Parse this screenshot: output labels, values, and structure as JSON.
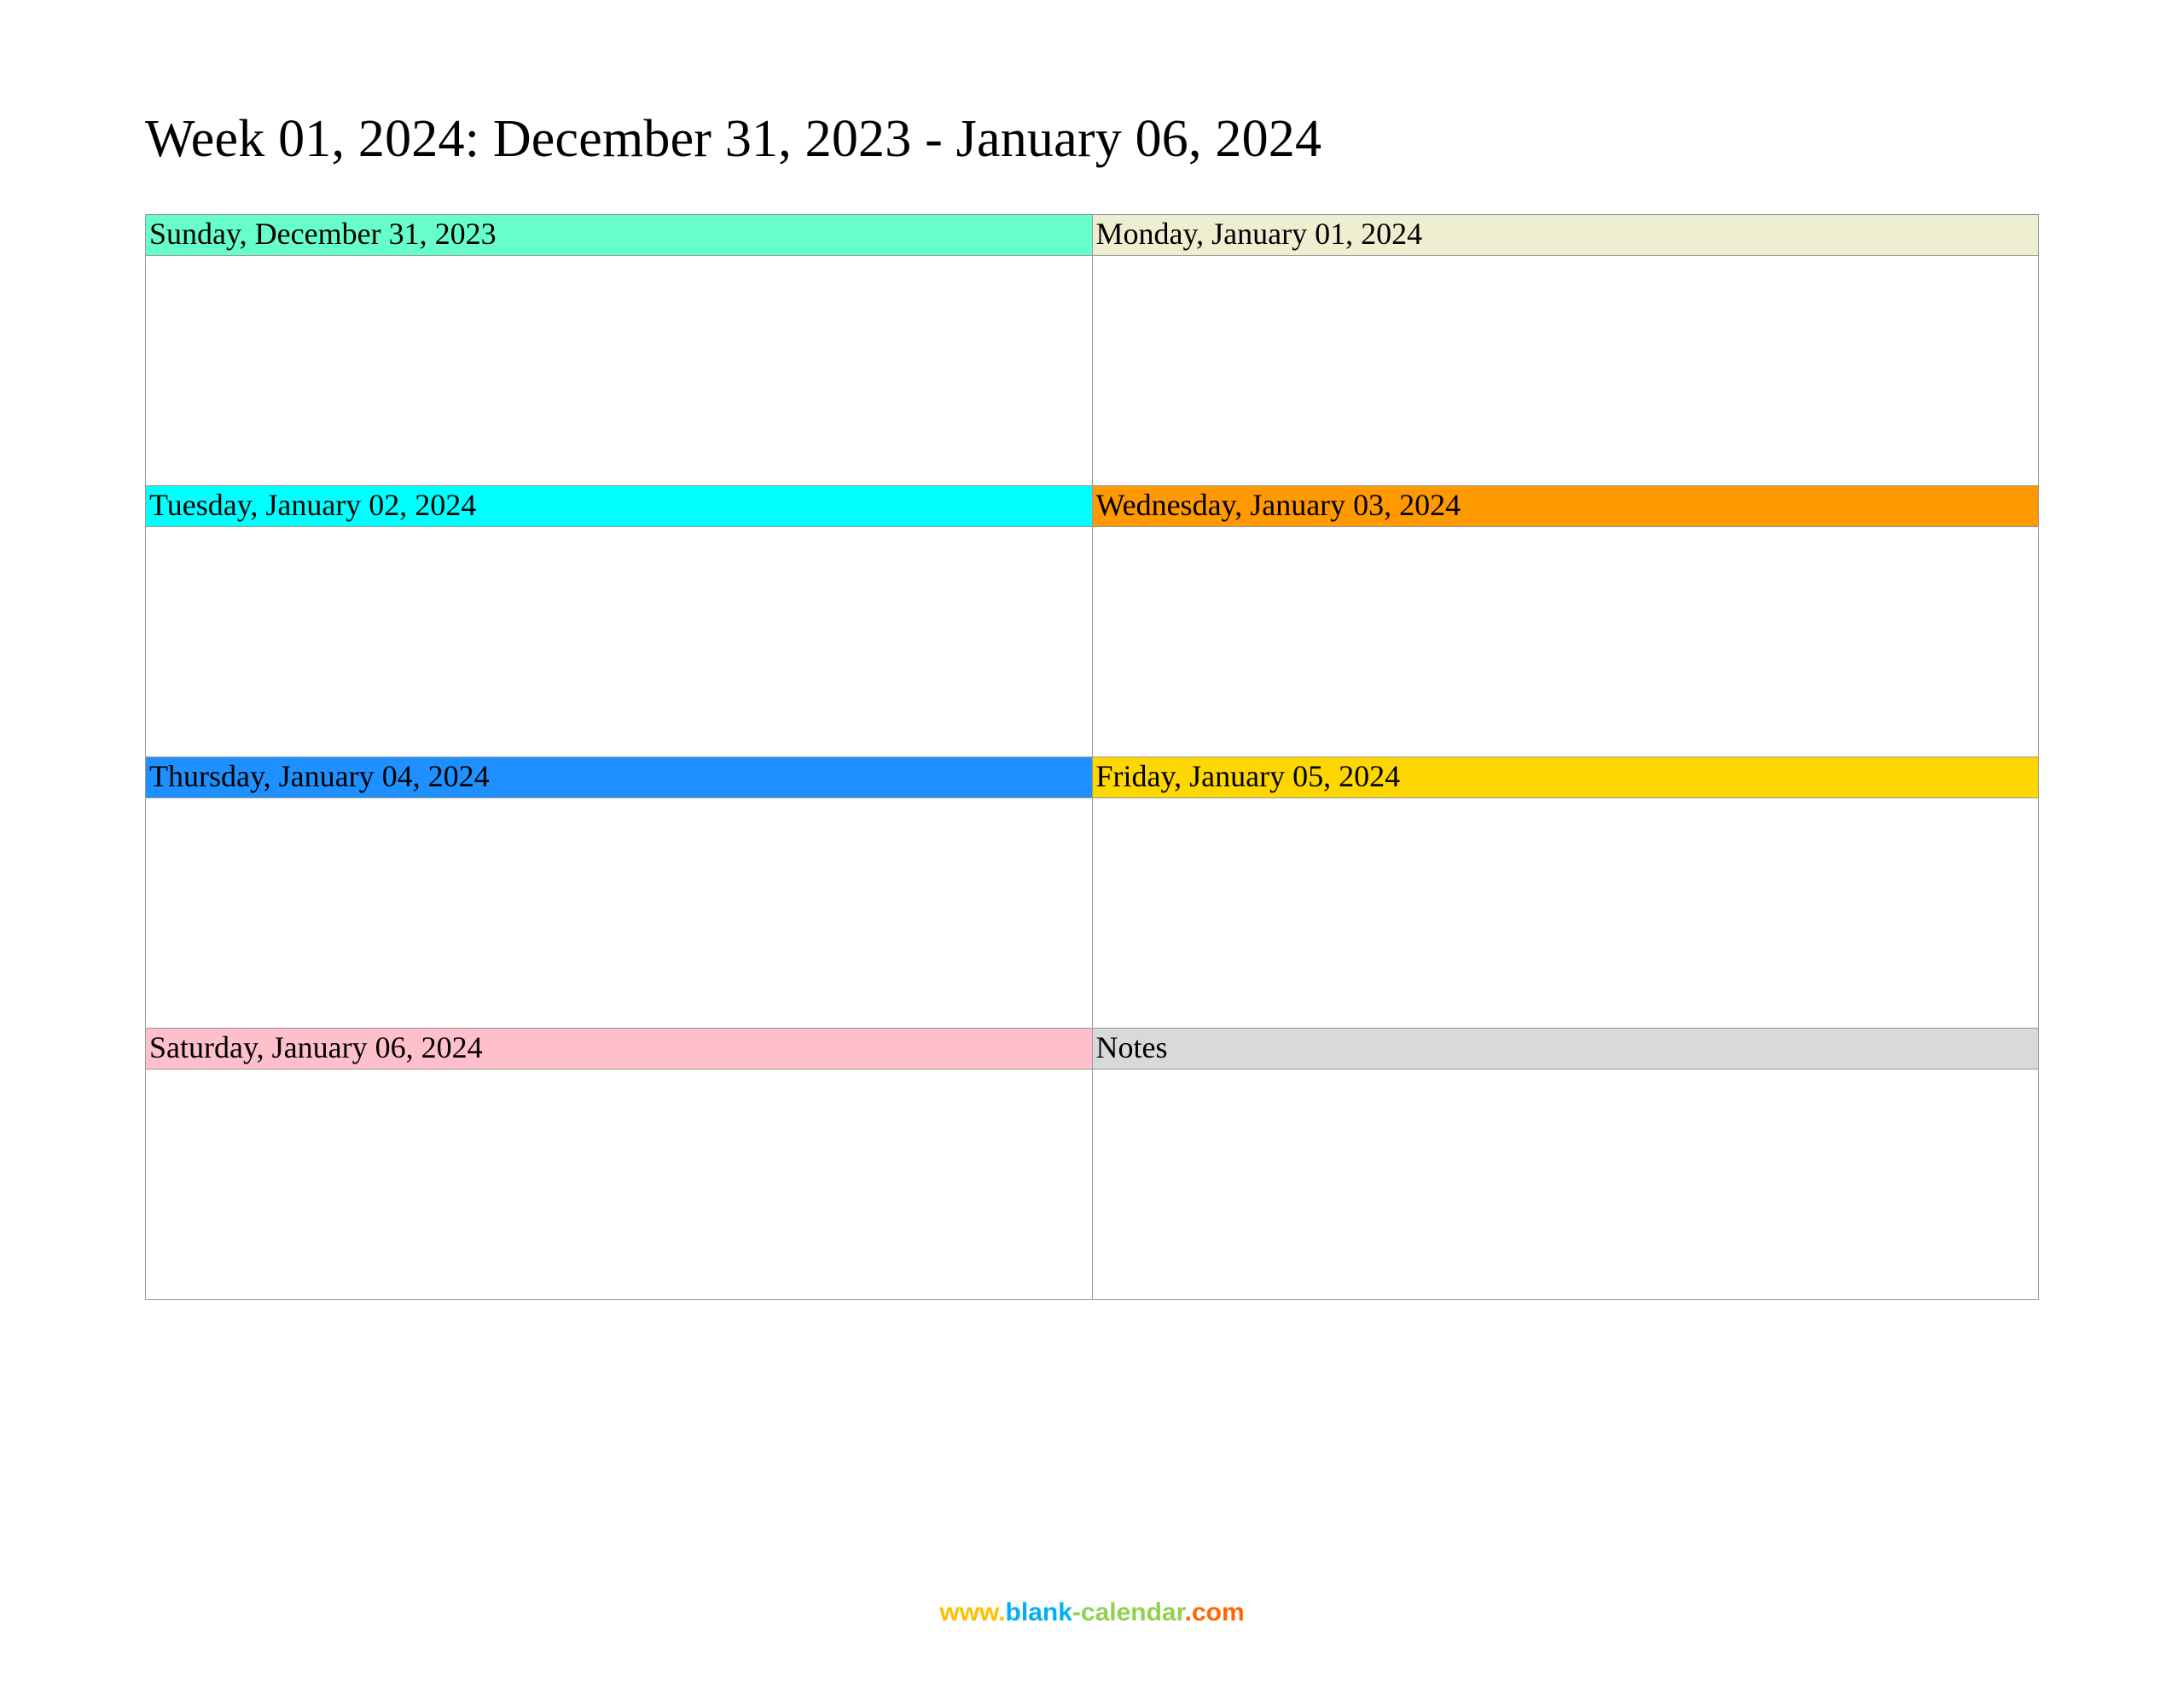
{
  "title": "Week 01, 2024: December 31, 2023 - January 06, 2024",
  "cells": [
    {
      "label": "Sunday, December 31, 2023",
      "bg": "#66ffcc"
    },
    {
      "label": "Monday, January 01, 2024",
      "bg": "#eeeed1"
    },
    {
      "label": "Tuesday, January 02, 2024",
      "bg": "#00ffff"
    },
    {
      "label": "Wednesday, January 03, 2024",
      "bg": "#ff9900"
    },
    {
      "label": "Thursday, January 04, 2024",
      "bg": "#1e90ff"
    },
    {
      "label": "Friday, January 05, 2024",
      "bg": "#ffd700"
    },
    {
      "label": "Saturday, January 06, 2024",
      "bg": "#ffc0cb"
    },
    {
      "label": "Notes",
      "bg": "#d9d9d9"
    }
  ],
  "footer": {
    "www": "www.",
    "blank": "blank",
    "cal": "-calendar",
    "com": ".com"
  }
}
